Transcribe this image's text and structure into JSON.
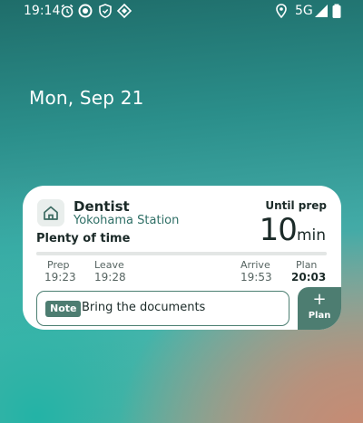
{
  "status_bar": {
    "time": "19:14",
    "network": "5G",
    "icons": [
      "alarm-icon",
      "data-saver-icon",
      "shield-icon",
      "vpn-diamond-icon",
      "location-icon",
      "signal-icon",
      "battery-icon"
    ]
  },
  "lock_screen": {
    "date": "Mon, Sep 21"
  },
  "widget": {
    "icon": "home-icon",
    "title": "Dentist",
    "subtitle": "Yokohama Station",
    "countdown_label": "Until prep",
    "countdown_value": "10",
    "countdown_unit": "min",
    "status": "Plenty of time",
    "progress_fraction": 1.0,
    "timeline": [
      {
        "label": "Prep",
        "value": "19:23"
      },
      {
        "label": "Leave",
        "value": "19:28"
      },
      {
        "label": "Arrive",
        "value": "19:53"
      },
      {
        "label": "Plan",
        "value": "20:03"
      }
    ],
    "note_badge": "Note",
    "note_text": "Bring the documents",
    "plan_button": {
      "icon": "plus-icon",
      "label": "Plan"
    },
    "colors": {
      "accent": "#4d7d71",
      "subtitle": "#2f6f66"
    }
  }
}
